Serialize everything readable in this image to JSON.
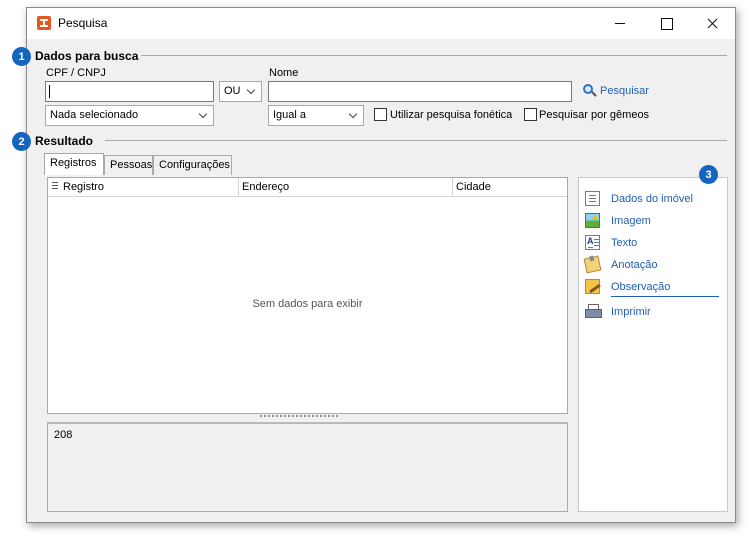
{
  "window": {
    "title": "Pesquisa"
  },
  "badges": {
    "search": "1",
    "result": "2",
    "side": "3"
  },
  "search": {
    "section_title": "Dados para busca",
    "cpf_label": "CPF / CNPJ",
    "cpf_value": "",
    "operator_value": "OU",
    "name_label": "Nome",
    "name_value": "",
    "search_link": "Pesquisar",
    "type_value": "Nada selecionado",
    "match_value": "Igual a",
    "phonetic_label": "Utilizar pesquisa fonética",
    "twins_label": "Pesquisar por gêmeos"
  },
  "result": {
    "section_title": "Resultado",
    "tabs": [
      "Registros",
      "Pessoas",
      "Configurações"
    ],
    "columns": [
      "Registro",
      "Endereço",
      "Cidade"
    ],
    "empty_message": "Sem dados para exibir",
    "memo_value": "208"
  },
  "side_panel": {
    "items": [
      {
        "label": "Dados do imóvel",
        "icon": "document-icon"
      },
      {
        "label": "Imagem",
        "icon": "image-icon"
      },
      {
        "label": "Texto",
        "icon": "text-icon"
      },
      {
        "label": "Anotação",
        "icon": "note-icon"
      },
      {
        "label": "Observação",
        "icon": "observation-icon"
      },
      {
        "label": "Imprimir",
        "icon": "printer-icon"
      }
    ]
  }
}
